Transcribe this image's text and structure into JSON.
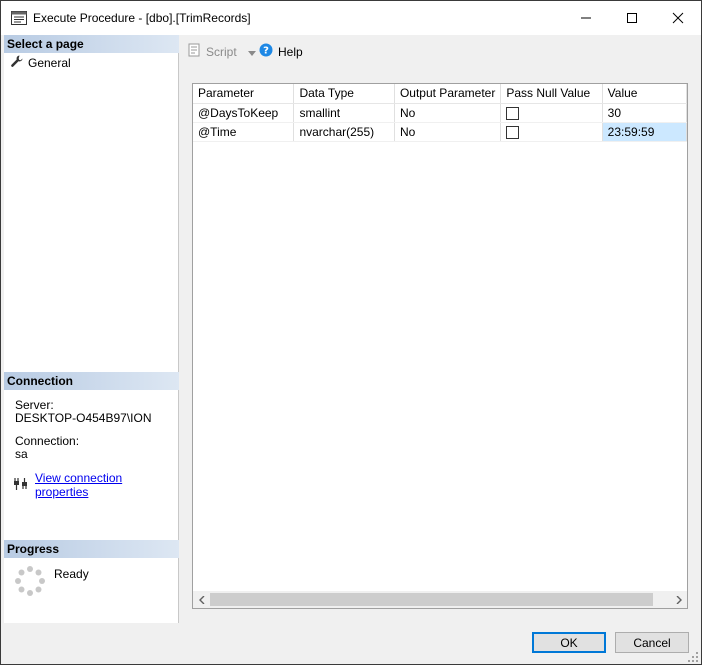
{
  "window": {
    "title": "Execute Procedure - [dbo].[TrimRecords]"
  },
  "sidebar": {
    "select_page_header": "Select a page",
    "pages": [
      {
        "label": "General",
        "icon": "wrench-icon"
      }
    ],
    "connection_header": "Connection",
    "server_label": "Server:",
    "server_value": "DESKTOP-O454B97\\ION",
    "connection_label": "Connection:",
    "connection_value": "sa",
    "view_connection_link": "View connection properties",
    "progress_header": "Progress",
    "progress_status": "Ready"
  },
  "toolbar": {
    "script_label": "Script",
    "help_label": "Help"
  },
  "grid": {
    "columns": [
      "Parameter",
      "Data Type",
      "Output Parameter",
      "Pass Null Value",
      "Value"
    ],
    "rows": [
      {
        "parameter": "@DaysToKeep",
        "data_type": "smallint",
        "output": "No",
        "pass_null": false,
        "value": "30"
      },
      {
        "parameter": "@Time",
        "data_type": "nvarchar(255)",
        "output": "No",
        "pass_null": false,
        "value": "23:59:59"
      }
    ]
  },
  "buttons": {
    "ok": "OK",
    "cancel": "Cancel"
  },
  "colors": {
    "accent": "#0078d7",
    "selected_cell": "#cce8ff",
    "section_header": "#b8cbe3"
  }
}
